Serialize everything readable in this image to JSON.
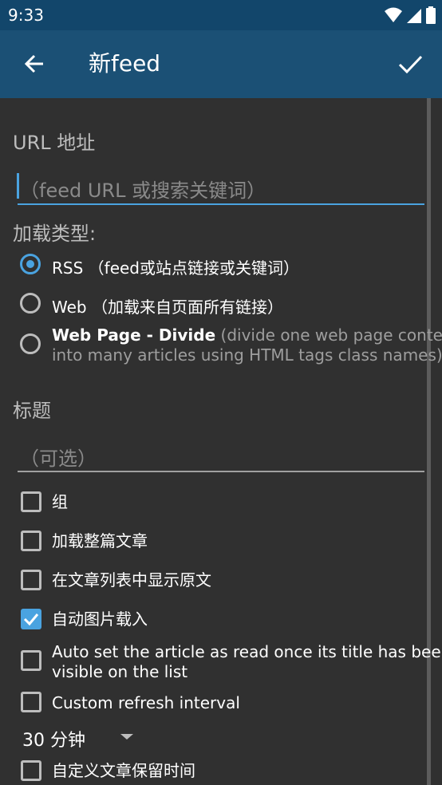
{
  "status": {
    "time": "9:33"
  },
  "app_bar": {
    "title": "新feed"
  },
  "url": {
    "label": "URL 地址",
    "placeholder": "（feed URL 或搜索关键词）"
  },
  "load_type": {
    "label": "加载类型:",
    "options": [
      {
        "title": "RSS",
        "desc": "（feed或站点链接或关键词）",
        "selected": true
      },
      {
        "title": "Web",
        "desc": "（加载来自页面所有链接）",
        "selected": false
      },
      {
        "title": "Web Page - Divide",
        "desc_line1": "(divide one web page content",
        "desc_line2": "into many articles using HTML tags class names)",
        "selected": false
      }
    ]
  },
  "title_field": {
    "label": "标题",
    "placeholder": "（可选）"
  },
  "checkboxes": [
    {
      "label": "组",
      "checked": false
    },
    {
      "label": "加载整篇文章",
      "checked": false
    },
    {
      "label": "在文章列表中显示原文",
      "checked": false
    },
    {
      "label": "自动图片载入",
      "checked": true
    },
    {
      "label_line1": "Auto set the article as read once its title has been",
      "label_line2": "visible on the list",
      "checked": false
    },
    {
      "label": "Custom refresh interval",
      "checked": false
    }
  ],
  "refresh": {
    "value": "30 分钟"
  },
  "retention": {
    "label": "自定义文章保留时间",
    "checked": false
  },
  "colors": {
    "accent": "#4aa3e0",
    "app_bar": "#1b5075",
    "status_bar": "#12466b",
    "background": "#303030"
  }
}
